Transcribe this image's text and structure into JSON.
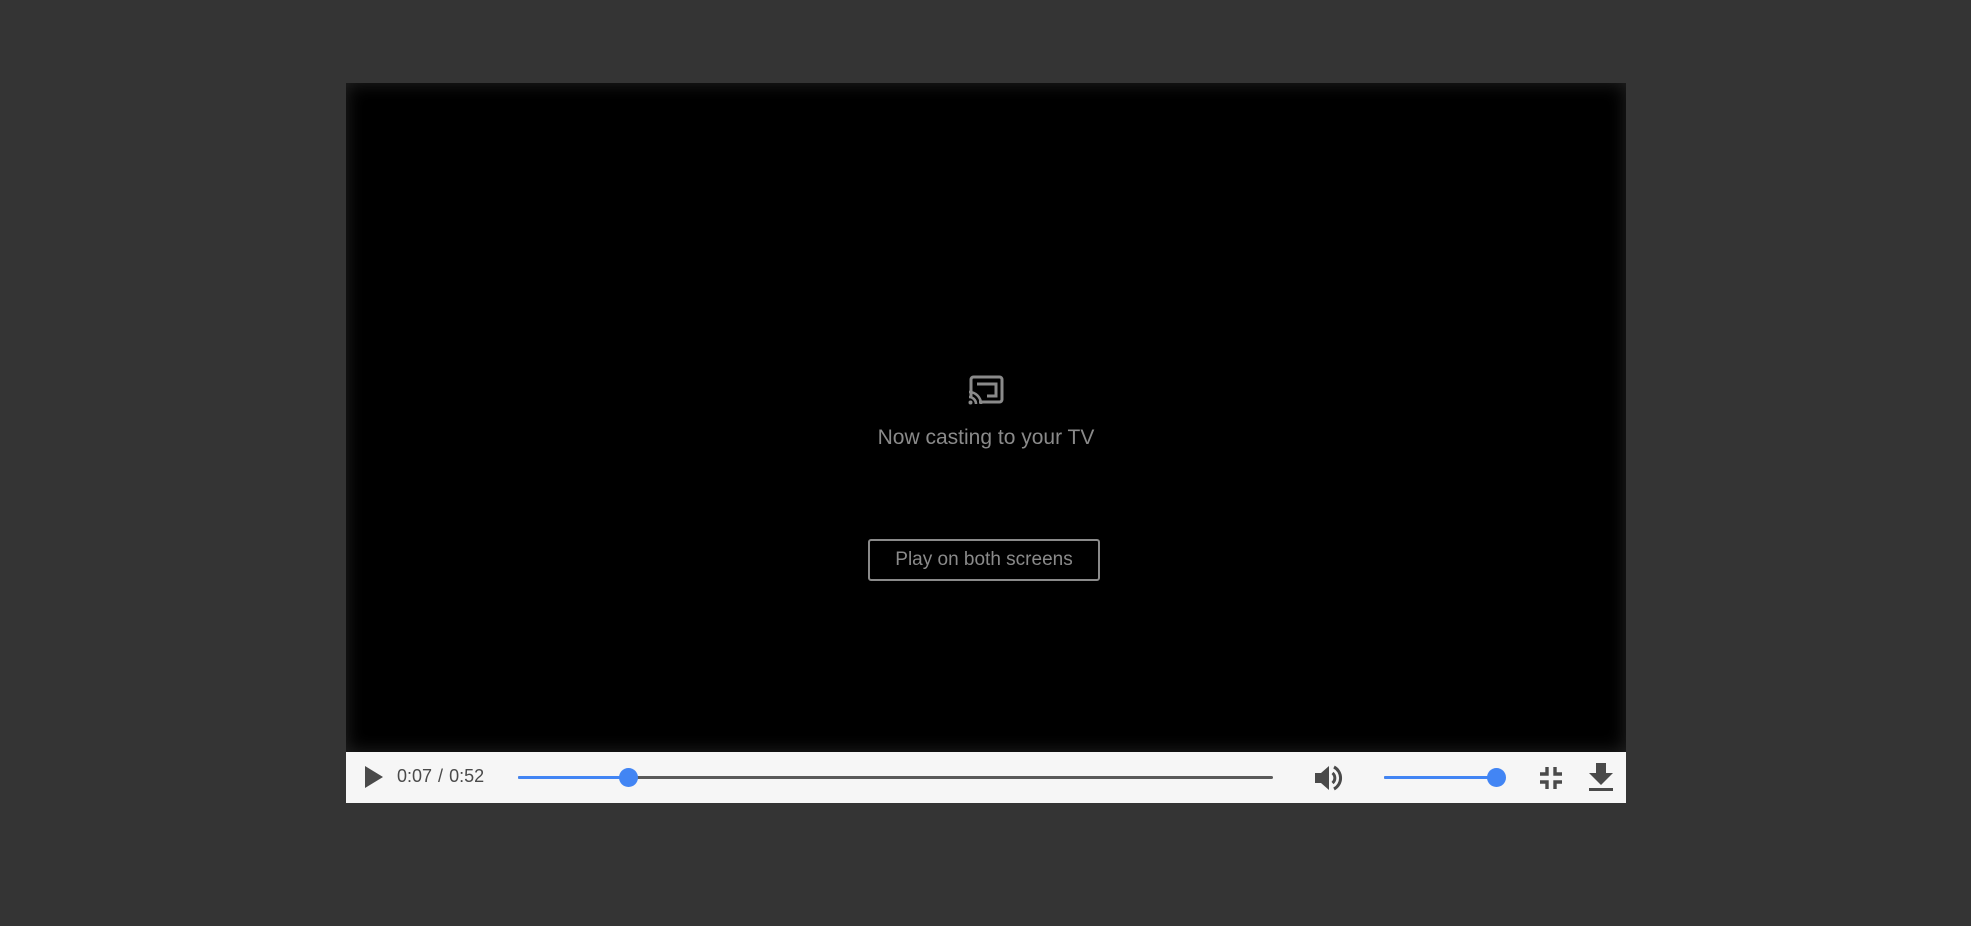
{
  "player": {
    "cast_message": "Now casting to your TV",
    "play_both_label": "Play on both screens",
    "current_time": "0:07",
    "separator": "/",
    "duration": "0:52",
    "progress_fraction": 0.146,
    "volume_fraction": 1.0,
    "accent_color": "#4285f4",
    "icons": {
      "cast": "cast-icon",
      "play": "play-icon",
      "volume": "volume-icon",
      "fullscreen_exit": "fullscreen-exit-icon",
      "download": "download-icon"
    }
  }
}
